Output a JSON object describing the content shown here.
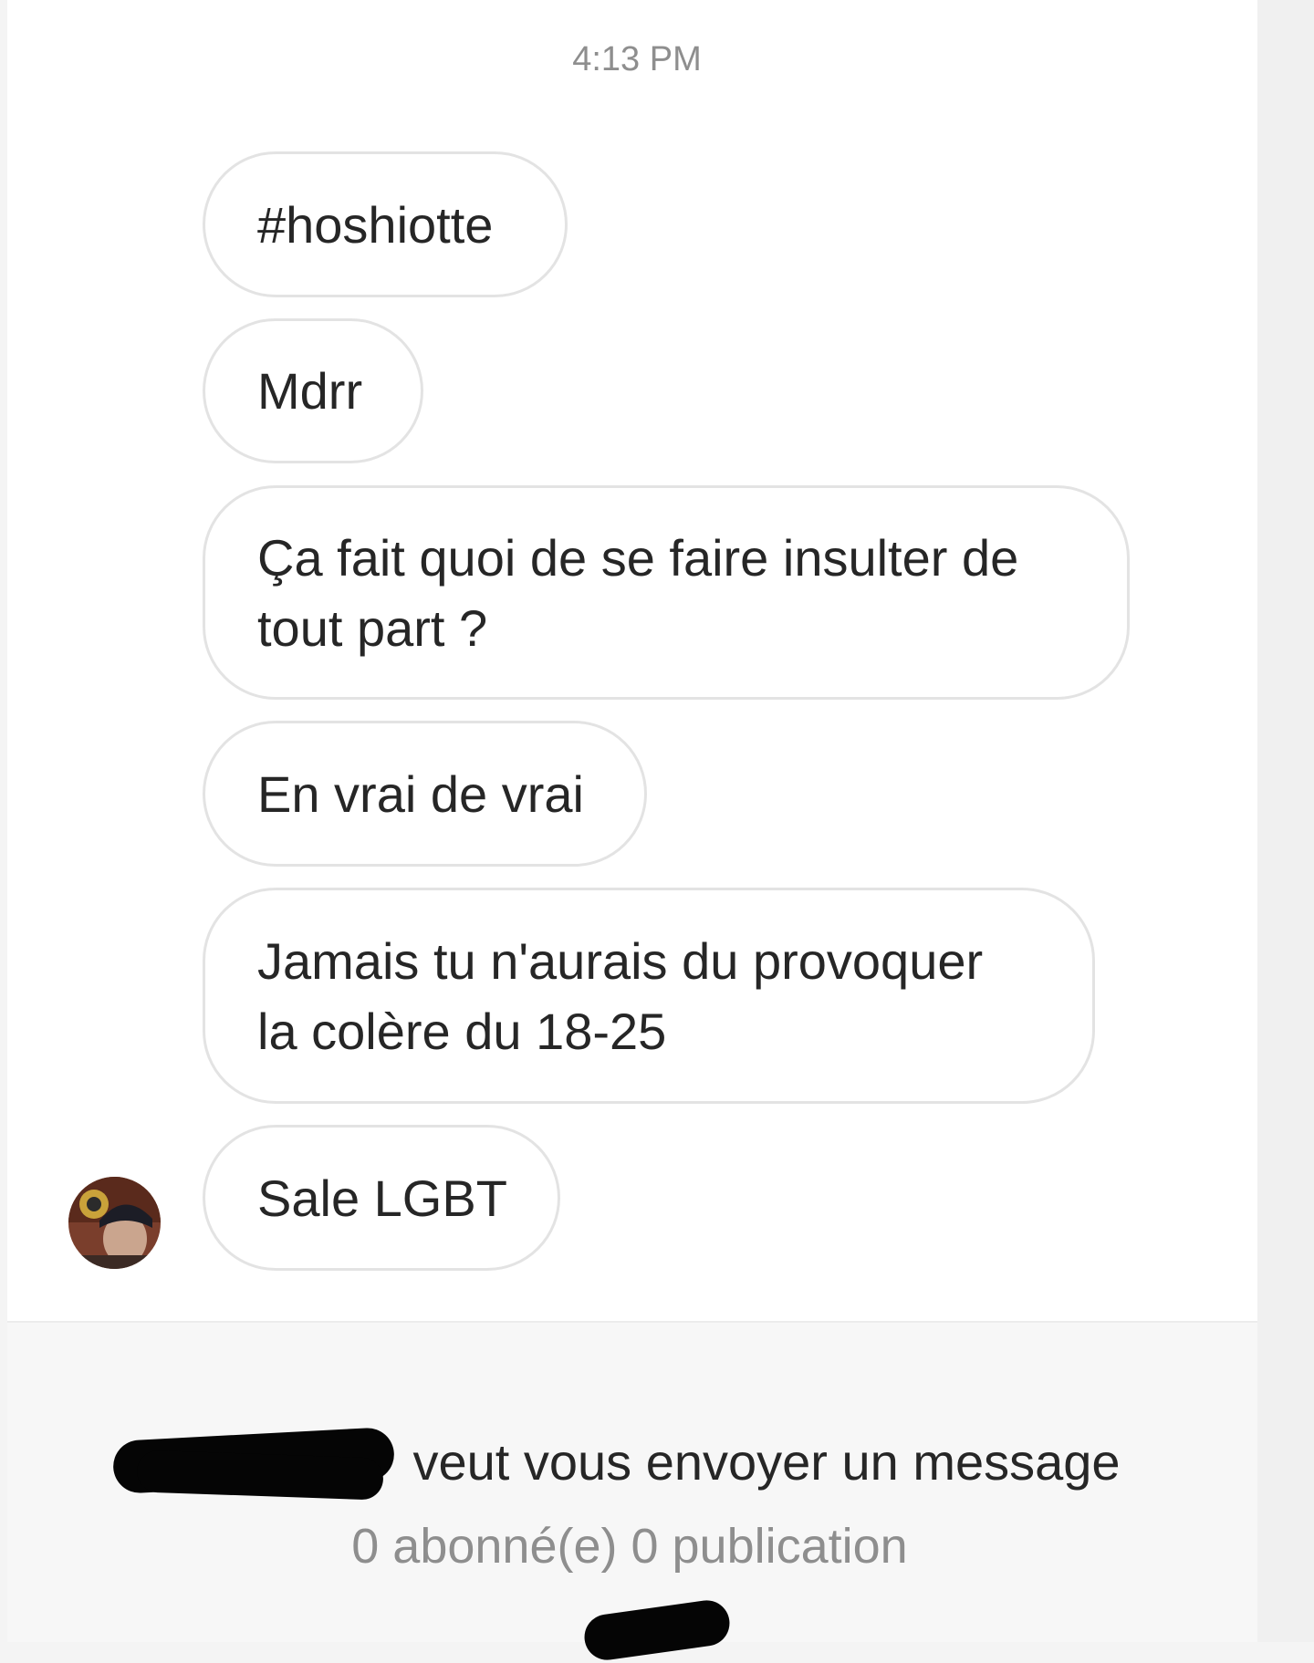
{
  "conversation": {
    "timestamp": "4:13 PM",
    "messages": [
      {
        "text": "#hoshiotte"
      },
      {
        "text": "Mdrr"
      },
      {
        "line1": "Ça fait quoi de se faire insulter de",
        "line2": "tout part ?"
      },
      {
        "text": "En vrai de vrai"
      },
      {
        "line1": "Jamais tu n'aurais du provoquer",
        "line2": "la colère du 18-25"
      },
      {
        "text": "Sale LGBT"
      }
    ]
  },
  "message_request": {
    "text": "veut vous envoyer un message",
    "stats": "0 abonné(e) 0 publication"
  },
  "colors": {
    "bubble_border": "#e3e3e3",
    "text": "#262626",
    "muted_text": "#8e8e8e",
    "redaction": "#050505"
  },
  "icons": {
    "avatar": "sender-avatar"
  }
}
